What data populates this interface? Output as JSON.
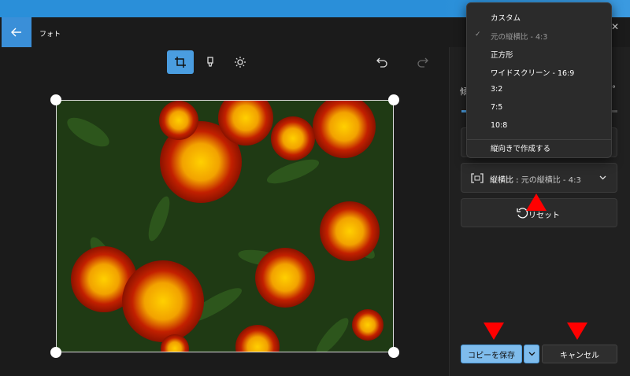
{
  "app": {
    "title": "フォト"
  },
  "toolbar": {
    "tools": [
      {
        "name": "crop",
        "active": true
      },
      {
        "name": "markup",
        "active": false
      },
      {
        "name": "adjust",
        "active": false
      }
    ]
  },
  "panel": {
    "ratio_label": "縦横比 :",
    "ratio_value": "元の縦横比 - 4:3",
    "reset_label": "リセット",
    "save_label": "コピーを保存",
    "cancel_label": "キャンセル"
  },
  "dropdown": {
    "items": [
      {
        "label": "カスタム",
        "checked": false,
        "dim": false
      },
      {
        "label": "元の縦横比 - 4:3",
        "checked": true,
        "dim": true
      },
      {
        "label": "正方形",
        "checked": false,
        "dim": false
      },
      {
        "label": "ワイドスクリーン - 16:9",
        "checked": false,
        "dim": false
      },
      {
        "label": "3:2",
        "checked": false,
        "dim": false
      },
      {
        "label": "7:5",
        "checked": false,
        "dim": false
      },
      {
        "label": "10:8",
        "checked": false,
        "dim": false
      }
    ],
    "footer": "縦向きで作成する"
  },
  "colors": {
    "accent": "#4a9de0",
    "save_bg": "#7fbcec",
    "annotation": "#ff0000"
  }
}
